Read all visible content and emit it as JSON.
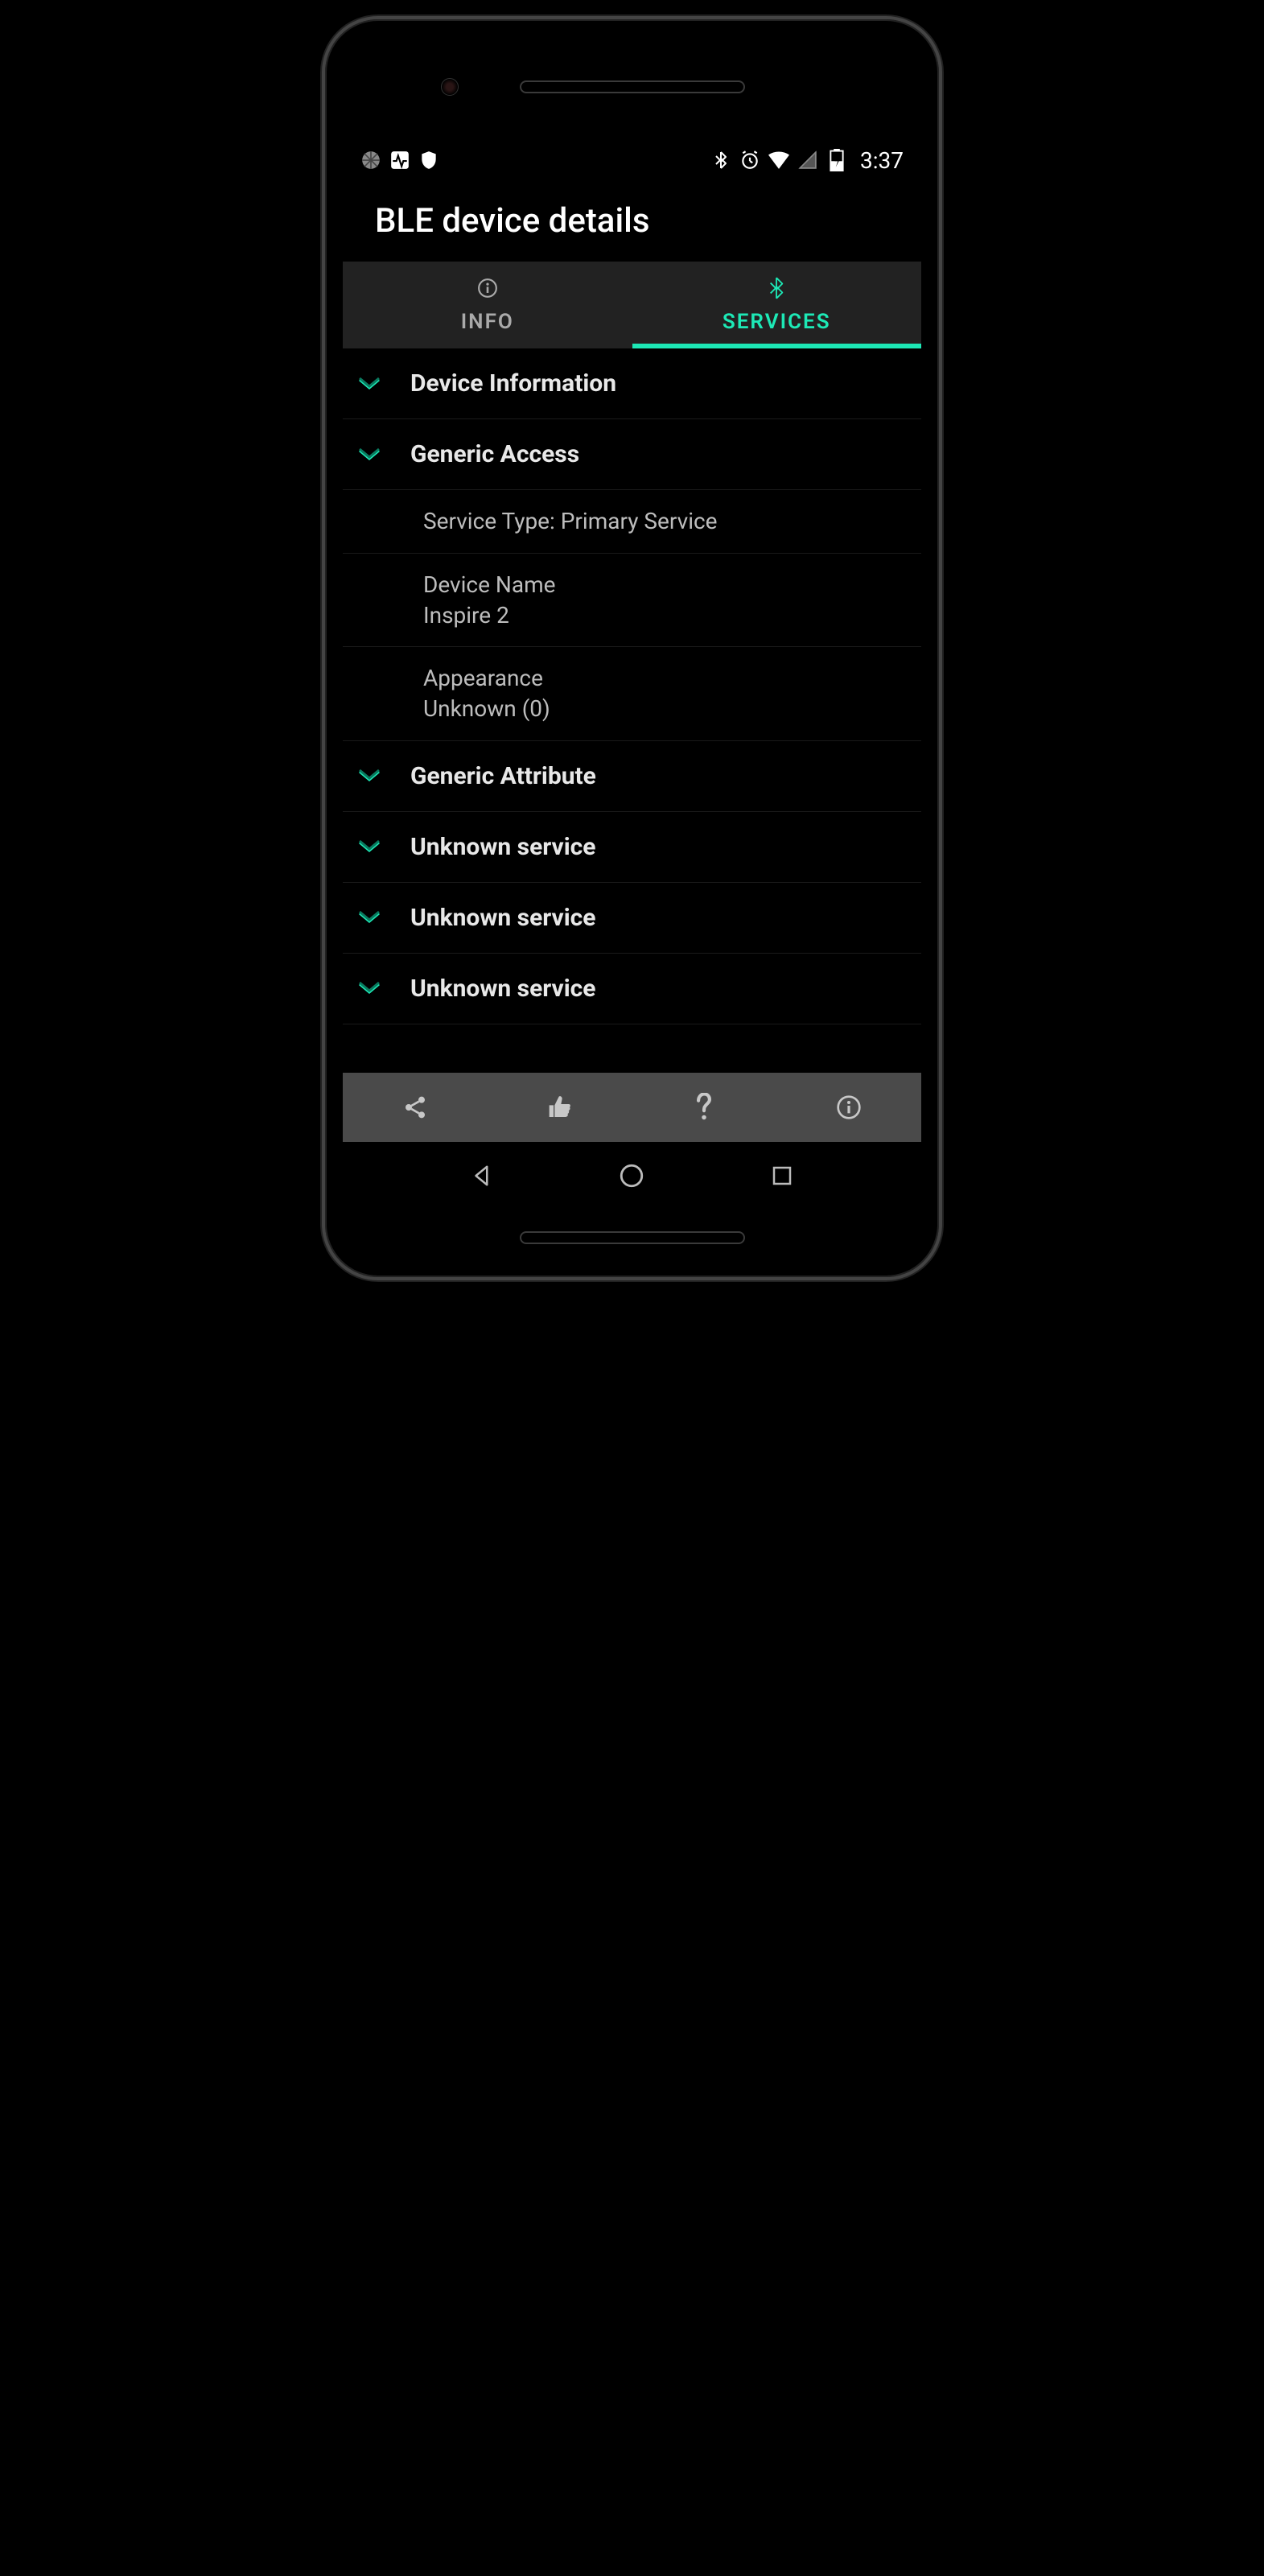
{
  "status": {
    "time": "3:37"
  },
  "header": {
    "title": "BLE device details"
  },
  "tabs": {
    "info": {
      "label": "INFO",
      "active": false
    },
    "services": {
      "label": "SERVICES",
      "active": true
    }
  },
  "services": [
    {
      "name": "Device Information",
      "expanded": false
    },
    {
      "name": "Generic Access",
      "expanded": true,
      "details": [
        {
          "line1": "Service Type: Primary Service"
        },
        {
          "line1": "Device Name",
          "line2": "Inspire 2"
        },
        {
          "line1": "Appearance",
          "line2": "Unknown (0)"
        }
      ]
    },
    {
      "name": "Generic Attribute",
      "expanded": false
    },
    {
      "name": "Unknown service",
      "expanded": false
    },
    {
      "name": "Unknown service",
      "expanded": false
    },
    {
      "name": "Unknown service",
      "expanded": false
    }
  ]
}
